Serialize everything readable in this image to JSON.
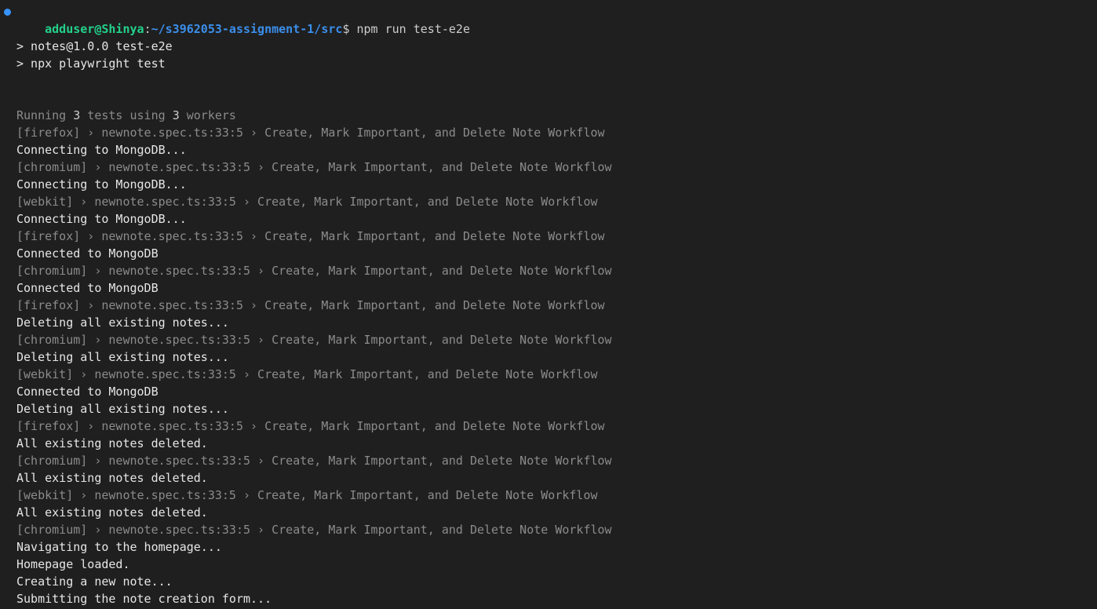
{
  "prompt": {
    "user_host": "adduser@Shinya",
    "colon": ":",
    "path": "~/s3962053-assignment-1/src",
    "dollar": "$",
    "command": " npm run test-e2e"
  },
  "script_header": [
    "> notes@1.0.0 test-e2e",
    "> npx playwright test"
  ],
  "running": {
    "prefix": "Running ",
    "tests": "3",
    "middle": " tests using ",
    "workers": "3",
    "suffix": " workers"
  },
  "log": [
    {
      "kind": "test",
      "text": "[firefox] › newnote.spec.ts:33:5 › Create, Mark Important, and Delete Note Workflow"
    },
    {
      "kind": "out",
      "text": "Connecting to MongoDB..."
    },
    {
      "kind": "test",
      "text": "[chromium] › newnote.spec.ts:33:5 › Create, Mark Important, and Delete Note Workflow"
    },
    {
      "kind": "out",
      "text": "Connecting to MongoDB..."
    },
    {
      "kind": "test",
      "text": "[webkit] › newnote.spec.ts:33:5 › Create, Mark Important, and Delete Note Workflow"
    },
    {
      "kind": "out",
      "text": "Connecting to MongoDB..."
    },
    {
      "kind": "test",
      "text": "[firefox] › newnote.spec.ts:33:5 › Create, Mark Important, and Delete Note Workflow"
    },
    {
      "kind": "out",
      "text": "Connected to MongoDB"
    },
    {
      "kind": "test",
      "text": "[chromium] › newnote.spec.ts:33:5 › Create, Mark Important, and Delete Note Workflow"
    },
    {
      "kind": "out",
      "text": "Connected to MongoDB"
    },
    {
      "kind": "test",
      "text": "[firefox] › newnote.spec.ts:33:5 › Create, Mark Important, and Delete Note Workflow"
    },
    {
      "kind": "out",
      "text": "Deleting all existing notes..."
    },
    {
      "kind": "test",
      "text": "[chromium] › newnote.spec.ts:33:5 › Create, Mark Important, and Delete Note Workflow"
    },
    {
      "kind": "out",
      "text": "Deleting all existing notes..."
    },
    {
      "kind": "test",
      "text": "[webkit] › newnote.spec.ts:33:5 › Create, Mark Important, and Delete Note Workflow"
    },
    {
      "kind": "out",
      "text": "Connected to MongoDB"
    },
    {
      "kind": "out",
      "text": "Deleting all existing notes..."
    },
    {
      "kind": "test",
      "text": "[firefox] › newnote.spec.ts:33:5 › Create, Mark Important, and Delete Note Workflow"
    },
    {
      "kind": "out",
      "text": "All existing notes deleted."
    },
    {
      "kind": "test",
      "text": "[chromium] › newnote.spec.ts:33:5 › Create, Mark Important, and Delete Note Workflow"
    },
    {
      "kind": "out",
      "text": "All existing notes deleted."
    },
    {
      "kind": "test",
      "text": "[webkit] › newnote.spec.ts:33:5 › Create, Mark Important, and Delete Note Workflow"
    },
    {
      "kind": "out",
      "text": "All existing notes deleted."
    },
    {
      "kind": "test",
      "text": "[chromium] › newnote.spec.ts:33:5 › Create, Mark Important, and Delete Note Workflow"
    },
    {
      "kind": "out",
      "text": "Navigating to the homepage..."
    },
    {
      "kind": "out",
      "text": "Homepage loaded."
    },
    {
      "kind": "out",
      "text": "Creating a new note..."
    },
    {
      "kind": "out",
      "text": "Submitting the note creation form..."
    }
  ]
}
